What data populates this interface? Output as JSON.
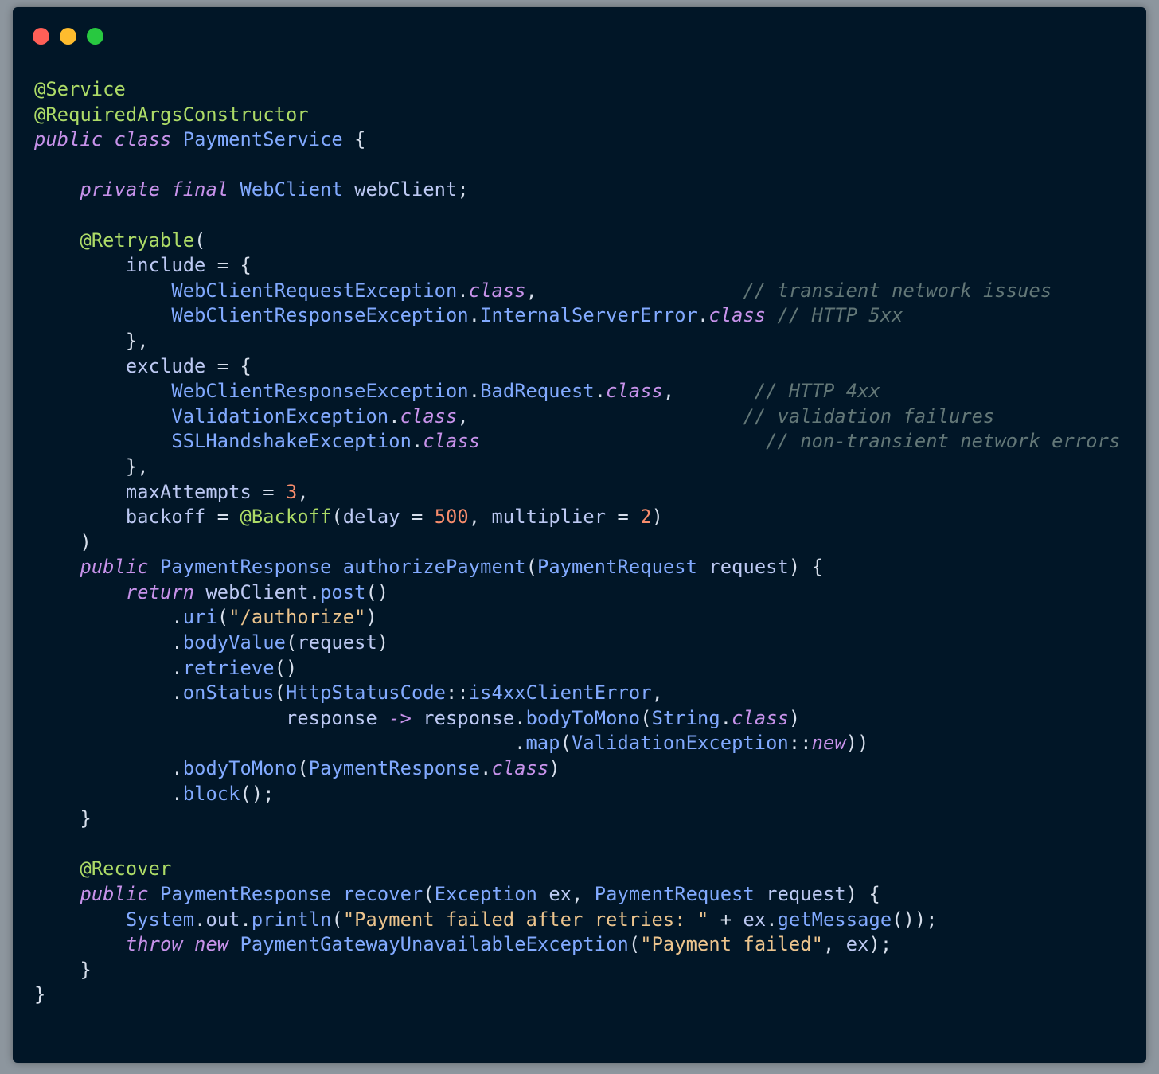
{
  "window": {
    "controls": [
      {
        "name": "close-dot",
        "color": "#ff5f57"
      },
      {
        "name": "minimize-dot",
        "color": "#febc2e"
      },
      {
        "name": "maximize-dot",
        "color": "#28c840"
      }
    ]
  },
  "theme": {
    "background": "#011627",
    "default": "#d6deeb",
    "annotation": "#addb67",
    "keyword": "#c792ea",
    "type": "#82aaff",
    "plain": "#bdc9f3",
    "string": "#ecc48d",
    "number": "#f78c6c",
    "comment": "#637777",
    "punct": "#d6deeb"
  },
  "code_lines": [
    [
      [
        "annotation",
        "@Service"
      ]
    ],
    [
      [
        "annotation",
        "@RequiredArgsConstructor"
      ]
    ],
    [
      [
        "keyword",
        "public"
      ],
      [
        "default",
        " "
      ],
      [
        "keyword",
        "class"
      ],
      [
        "default",
        " "
      ],
      [
        "type",
        "PaymentService"
      ],
      [
        "punct",
        " {"
      ]
    ],
    [],
    [
      [
        "default",
        "    "
      ],
      [
        "keyword",
        "private"
      ],
      [
        "default",
        " "
      ],
      [
        "keyword",
        "final"
      ],
      [
        "default",
        " "
      ],
      [
        "type",
        "WebClient"
      ],
      [
        "plain",
        " webClient"
      ],
      [
        "punct",
        ";"
      ]
    ],
    [],
    [
      [
        "default",
        "    "
      ],
      [
        "annotation",
        "@Retryable"
      ],
      [
        "punct",
        "("
      ]
    ],
    [
      [
        "default",
        "        "
      ],
      [
        "plain",
        "include"
      ],
      [
        "punct",
        " = {"
      ]
    ],
    [
      [
        "default",
        "            "
      ],
      [
        "type",
        "WebClientRequestException"
      ],
      [
        "punct",
        "."
      ],
      [
        "keyword",
        "class"
      ],
      [
        "punct",
        ","
      ],
      [
        "default",
        "                  "
      ],
      [
        "comment",
        "// transient network issues"
      ]
    ],
    [
      [
        "default",
        "            "
      ],
      [
        "type",
        "WebClientResponseException"
      ],
      [
        "punct",
        "."
      ],
      [
        "type",
        "InternalServerError"
      ],
      [
        "punct",
        "."
      ],
      [
        "keyword",
        "class"
      ],
      [
        "default",
        " "
      ],
      [
        "comment",
        "// HTTP 5xx"
      ]
    ],
    [
      [
        "default",
        "        "
      ],
      [
        "punct",
        "},"
      ]
    ],
    [
      [
        "default",
        "        "
      ],
      [
        "plain",
        "exclude"
      ],
      [
        "punct",
        " = {"
      ]
    ],
    [
      [
        "default",
        "            "
      ],
      [
        "type",
        "WebClientResponseException"
      ],
      [
        "punct",
        "."
      ],
      [
        "type",
        "BadRequest"
      ],
      [
        "punct",
        "."
      ],
      [
        "keyword",
        "class"
      ],
      [
        "punct",
        ","
      ],
      [
        "default",
        "       "
      ],
      [
        "comment",
        "// HTTP 4xx"
      ]
    ],
    [
      [
        "default",
        "            "
      ],
      [
        "type",
        "ValidationException"
      ],
      [
        "punct",
        "."
      ],
      [
        "keyword",
        "class"
      ],
      [
        "punct",
        ","
      ],
      [
        "default",
        "                        "
      ],
      [
        "comment",
        "// validation failures"
      ]
    ],
    [
      [
        "default",
        "            "
      ],
      [
        "type",
        "SSLHandshakeException"
      ],
      [
        "punct",
        "."
      ],
      [
        "keyword",
        "class"
      ],
      [
        "default",
        "                         "
      ],
      [
        "comment",
        "// non-transient network errors"
      ]
    ],
    [
      [
        "default",
        "        "
      ],
      [
        "punct",
        "},"
      ]
    ],
    [
      [
        "default",
        "        "
      ],
      [
        "plain",
        "maxAttempts"
      ],
      [
        "punct",
        " = "
      ],
      [
        "number",
        "3"
      ],
      [
        "punct",
        ","
      ]
    ],
    [
      [
        "default",
        "        "
      ],
      [
        "plain",
        "backoff"
      ],
      [
        "punct",
        " = "
      ],
      [
        "annotation",
        "@Backoff"
      ],
      [
        "punct",
        "("
      ],
      [
        "plain",
        "delay"
      ],
      [
        "punct",
        " = "
      ],
      [
        "number",
        "500"
      ],
      [
        "punct",
        ", "
      ],
      [
        "plain",
        "multiplier"
      ],
      [
        "punct",
        " = "
      ],
      [
        "number",
        "2"
      ],
      [
        "punct",
        ")"
      ]
    ],
    [
      [
        "default",
        "    "
      ],
      [
        "punct",
        ")"
      ]
    ],
    [
      [
        "default",
        "    "
      ],
      [
        "keyword",
        "public"
      ],
      [
        "default",
        " "
      ],
      [
        "type",
        "PaymentResponse"
      ],
      [
        "default",
        " "
      ],
      [
        "type",
        "authorizePayment"
      ],
      [
        "punct",
        "("
      ],
      [
        "type",
        "PaymentRequest"
      ],
      [
        "plain",
        " request"
      ],
      [
        "punct",
        ") {"
      ]
    ],
    [
      [
        "default",
        "        "
      ],
      [
        "keyword",
        "return"
      ],
      [
        "plain",
        " webClient"
      ],
      [
        "punct",
        "."
      ],
      [
        "type",
        "post"
      ],
      [
        "punct",
        "()"
      ]
    ],
    [
      [
        "default",
        "            "
      ],
      [
        "punct",
        "."
      ],
      [
        "type",
        "uri"
      ],
      [
        "punct",
        "("
      ],
      [
        "string",
        "\"/authorize\""
      ],
      [
        "punct",
        ")"
      ]
    ],
    [
      [
        "default",
        "            "
      ],
      [
        "punct",
        "."
      ],
      [
        "type",
        "bodyValue"
      ],
      [
        "punct",
        "("
      ],
      [
        "plain",
        "request"
      ],
      [
        "punct",
        ")"
      ]
    ],
    [
      [
        "default",
        "            "
      ],
      [
        "punct",
        "."
      ],
      [
        "type",
        "retrieve"
      ],
      [
        "punct",
        "()"
      ]
    ],
    [
      [
        "default",
        "            "
      ],
      [
        "punct",
        "."
      ],
      [
        "type",
        "onStatus"
      ],
      [
        "punct",
        "("
      ],
      [
        "type",
        "HttpStatusCode"
      ],
      [
        "punct",
        "::"
      ],
      [
        "type",
        "is4xxClientError"
      ],
      [
        "punct",
        ","
      ]
    ],
    [
      [
        "default",
        "                      "
      ],
      [
        "plain",
        "response"
      ],
      [
        "keyword",
        " -> "
      ],
      [
        "plain",
        "response"
      ],
      [
        "punct",
        "."
      ],
      [
        "type",
        "bodyToMono"
      ],
      [
        "punct",
        "("
      ],
      [
        "type",
        "String"
      ],
      [
        "punct",
        "."
      ],
      [
        "keyword",
        "class"
      ],
      [
        "punct",
        ")"
      ]
    ],
    [
      [
        "default",
        "                                          "
      ],
      [
        "punct",
        "."
      ],
      [
        "type",
        "map"
      ],
      [
        "punct",
        "("
      ],
      [
        "type",
        "ValidationException"
      ],
      [
        "punct",
        "::"
      ],
      [
        "keyword",
        "new"
      ],
      [
        "punct",
        "))"
      ]
    ],
    [
      [
        "default",
        "            "
      ],
      [
        "punct",
        "."
      ],
      [
        "type",
        "bodyToMono"
      ],
      [
        "punct",
        "("
      ],
      [
        "type",
        "PaymentResponse"
      ],
      [
        "punct",
        "."
      ],
      [
        "keyword",
        "class"
      ],
      [
        "punct",
        ")"
      ]
    ],
    [
      [
        "default",
        "            "
      ],
      [
        "punct",
        "."
      ],
      [
        "type",
        "block"
      ],
      [
        "punct",
        "();"
      ]
    ],
    [
      [
        "default",
        "    "
      ],
      [
        "punct",
        "}"
      ]
    ],
    [],
    [
      [
        "default",
        "    "
      ],
      [
        "annotation",
        "@Recover"
      ]
    ],
    [
      [
        "default",
        "    "
      ],
      [
        "keyword",
        "public"
      ],
      [
        "default",
        " "
      ],
      [
        "type",
        "PaymentResponse"
      ],
      [
        "default",
        " "
      ],
      [
        "type",
        "recover"
      ],
      [
        "punct",
        "("
      ],
      [
        "type",
        "Exception"
      ],
      [
        "plain",
        " ex"
      ],
      [
        "punct",
        ", "
      ],
      [
        "type",
        "PaymentRequest"
      ],
      [
        "plain",
        " request"
      ],
      [
        "punct",
        ") {"
      ]
    ],
    [
      [
        "default",
        "        "
      ],
      [
        "type",
        "System"
      ],
      [
        "punct",
        "."
      ],
      [
        "plain",
        "out"
      ],
      [
        "punct",
        "."
      ],
      [
        "type",
        "println"
      ],
      [
        "punct",
        "("
      ],
      [
        "string",
        "\"Payment failed after retries: \""
      ],
      [
        "punct",
        " + "
      ],
      [
        "plain",
        "ex"
      ],
      [
        "punct",
        "."
      ],
      [
        "type",
        "getMessage"
      ],
      [
        "punct",
        "());"
      ]
    ],
    [
      [
        "default",
        "        "
      ],
      [
        "keyword",
        "throw"
      ],
      [
        "default",
        " "
      ],
      [
        "keyword",
        "new"
      ],
      [
        "default",
        " "
      ],
      [
        "type",
        "PaymentGatewayUnavailableException"
      ],
      [
        "punct",
        "("
      ],
      [
        "string",
        "\"Payment failed\""
      ],
      [
        "punct",
        ", "
      ],
      [
        "plain",
        "ex"
      ],
      [
        "punct",
        ");"
      ]
    ],
    [
      [
        "default",
        "    "
      ],
      [
        "punct",
        "}"
      ]
    ],
    [
      [
        "punct",
        "}"
      ]
    ]
  ]
}
